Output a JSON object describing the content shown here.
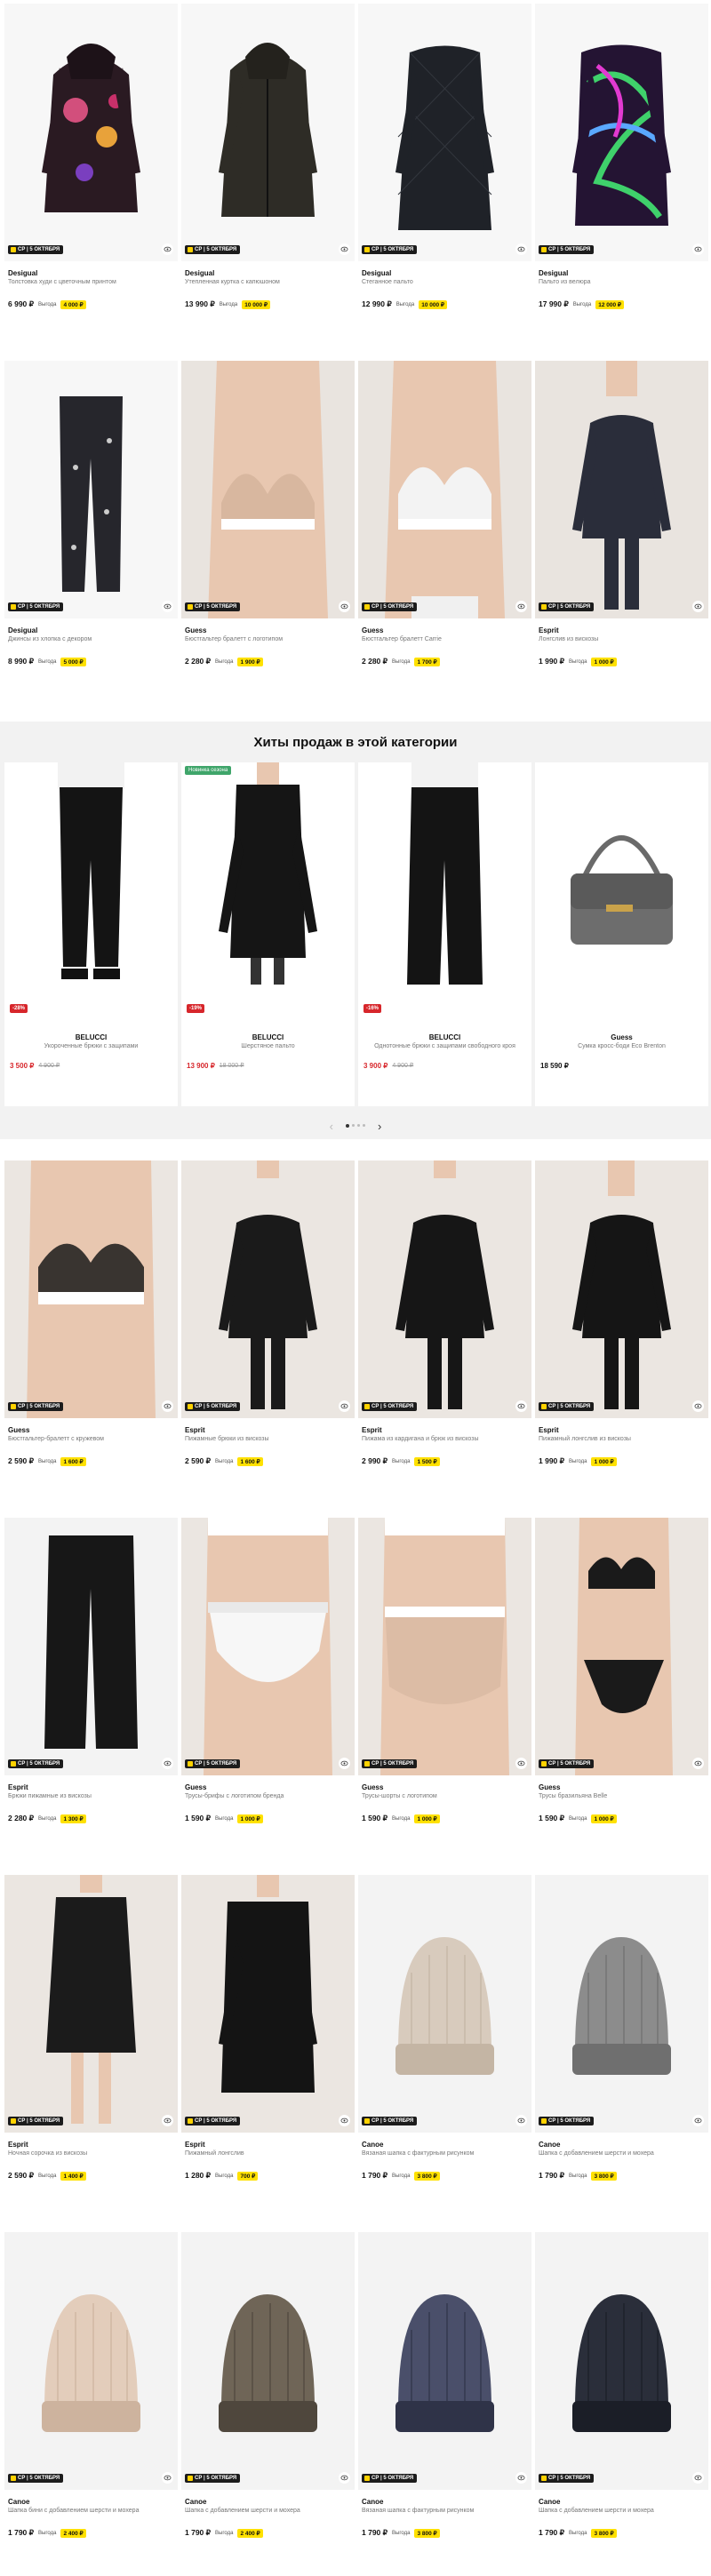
{
  "delivery_badge": "СР | 5 ОКТЯБРЯ",
  "saving_label": "Выгода",
  "rows_top": [
    [
      {
        "brand": "Desigual",
        "desc": "Толстовка худи с цветочным принтом",
        "price": "6 990 ₽",
        "save": "4 000 ₽",
        "kind": "hoodie-floral"
      },
      {
        "brand": "Desigual",
        "desc": "Утепленная куртка с капюшоном",
        "price": "13 990 ₽",
        "save": "10 000 ₽",
        "kind": "jacket-dark"
      },
      {
        "brand": "Desigual",
        "desc": "Стеганное пальто",
        "price": "12 990 ₽",
        "save": "10 000 ₽",
        "kind": "quilted-coat"
      },
      {
        "brand": "Desigual",
        "desc": "Пальто из велюра",
        "price": "17 990 ₽",
        "save": "12 000 ₽",
        "kind": "velour-coat"
      }
    ],
    [
      {
        "brand": "Desigual",
        "desc": "Джинсы из хлопка с декором",
        "price": "8 990 ₽",
        "save": "5 000 ₽",
        "kind": "jeans"
      },
      {
        "brand": "Guess",
        "desc": "Бюстгальтер бралетт с логотипом",
        "price": "2 280 ₽",
        "save": "1 900 ₽",
        "kind": "bra-nude"
      },
      {
        "brand": "Guess",
        "desc": "Бюстгальтер бралетт Carrie",
        "price": "2 280 ₽",
        "save": "1 700 ₽",
        "kind": "bra-white"
      },
      {
        "brand": "Esprit",
        "desc": "Лонгслив из вискозы",
        "price": "1 990 ₽",
        "save": "1 000 ₽",
        "kind": "longsleeve"
      }
    ]
  ],
  "hits": {
    "title": "Хиты продаж в этой категории",
    "new_tag": "Новинка сезона",
    "items": [
      {
        "brand": "BELUCCI",
        "desc": "Укороченные брюки с защипами",
        "price": "3 500 ₽",
        "old": "4 900 ₽",
        "discount": "-28%",
        "kind": "pants-black"
      },
      {
        "brand": "BELUCCI",
        "desc": "Шерстяное пальто",
        "price": "13 900 ₽",
        "old": "18 000 ₽",
        "discount": "-19%",
        "kind": "coat-black",
        "new": true
      },
      {
        "brand": "BELUCCI",
        "desc": "Однотонные брюки с защипами свободного кроя",
        "price": "3 900 ₽",
        "old": "4 900 ₽",
        "discount": "-16%",
        "kind": "pants-wide"
      },
      {
        "brand": "Guess",
        "desc": "Сумка кросс-боди Eco Brenton",
        "price": "18 590 ₽",
        "old": "",
        "discount": "",
        "kind": "bag"
      }
    ],
    "pager_prev": "‹",
    "pager_next": "›"
  },
  "rows_bottom": [
    [
      {
        "brand": "Guess",
        "desc": "Бюстгальтер-бралетт с кружевом",
        "price": "2 590 ₽",
        "save": "1 600 ₽",
        "kind": "bra-lace"
      },
      {
        "brand": "Esprit",
        "desc": "Пижамные брюки из вискозы",
        "price": "2 590 ₽",
        "save": "1 600 ₽",
        "kind": "pajama-pants"
      },
      {
        "brand": "Esprit",
        "desc": "Пижама из кардигана и брюк из вискозы",
        "price": "2 990 ₽",
        "save": "1 500 ₽",
        "kind": "pajama-set"
      },
      {
        "brand": "Esprit",
        "desc": "Пижамный лонгслив из вискозы",
        "price": "1 990 ₽",
        "save": "1 000 ₽",
        "kind": "longsleeve-black"
      }
    ],
    [
      {
        "brand": "Esprit",
        "desc": "Брюки пижамные из вискозы",
        "price": "2 280 ₽",
        "save": "1 300 ₽",
        "kind": "pants-flat"
      },
      {
        "brand": "Guess",
        "desc": "Трусы-брифы с логотипом бренда",
        "price": "1 590 ₽",
        "save": "1 000 ₽",
        "kind": "brief-white"
      },
      {
        "brand": "Guess",
        "desc": "Трусы-шорты с логотипом",
        "price": "1 590 ₽",
        "save": "1 000 ₽",
        "kind": "brief-nude"
      },
      {
        "brand": "Guess",
        "desc": "Трусы бразильяна Belle",
        "price": "1 590 ₽",
        "save": "1 000 ₽",
        "kind": "lingerie-black"
      }
    ],
    [
      {
        "brand": "Esprit",
        "desc": "Ночная сорочка из вискозы",
        "price": "2 590 ₽",
        "save": "1 400 ₽",
        "kind": "nightdress"
      },
      {
        "brand": "Esprit",
        "desc": "Пижамный лонгслив",
        "price": "1 280 ₽",
        "save": "700 ₽",
        "kind": "sweater-black"
      },
      {
        "brand": "Canoe",
        "desc": "Вязаная шапка с фактурным рисунком",
        "price": "1 790 ₽",
        "save": "3 800 ₽",
        "kind": "beanie-beige"
      },
      {
        "brand": "Canoe",
        "desc": "Шапка с добавлением шерсти и мохера",
        "price": "1 790 ₽",
        "save": "3 800 ₽",
        "kind": "beanie-grey"
      }
    ],
    [
      {
        "brand": "Canoe",
        "desc": "Шапка бини с добавлением шерсти и мохера",
        "price": "1 790 ₽",
        "save": "2 400 ₽",
        "kind": "beanie-cable"
      },
      {
        "brand": "Canoe",
        "desc": "Шапка с добавлением шерсти и мохера",
        "price": "1 790 ₽",
        "save": "2 400 ₽",
        "kind": "beanie-brown"
      },
      {
        "brand": "Canoe",
        "desc": "Вязаная шапка с фактурным рисунком",
        "price": "1 790 ₽",
        "save": "3 800 ₽",
        "kind": "beanie-navy"
      },
      {
        "brand": "Canoe",
        "desc": "Шапка с добавлением шерсти и мохера",
        "price": "1 790 ₽",
        "save": "3 800 ₽",
        "kind": "beanie-dark"
      }
    ]
  ]
}
